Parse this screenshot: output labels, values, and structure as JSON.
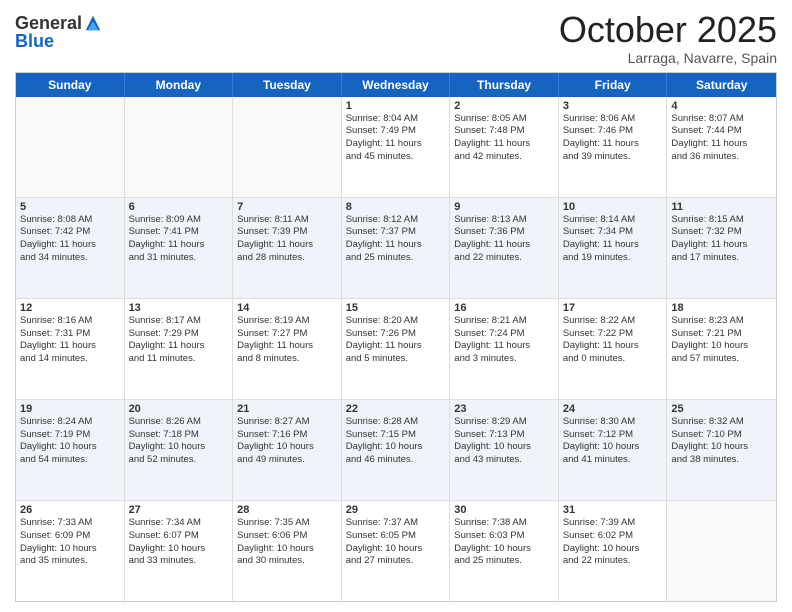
{
  "header": {
    "logo_general": "General",
    "logo_blue": "Blue",
    "month": "October 2025",
    "location": "Larraga, Navarre, Spain"
  },
  "weekdays": [
    "Sunday",
    "Monday",
    "Tuesday",
    "Wednesday",
    "Thursday",
    "Friday",
    "Saturday"
  ],
  "rows": [
    {
      "alt": false,
      "cells": [
        {
          "day": "",
          "lines": []
        },
        {
          "day": "",
          "lines": []
        },
        {
          "day": "",
          "lines": []
        },
        {
          "day": "1",
          "lines": [
            "Sunrise: 8:04 AM",
            "Sunset: 7:49 PM",
            "Daylight: 11 hours",
            "and 45 minutes."
          ]
        },
        {
          "day": "2",
          "lines": [
            "Sunrise: 8:05 AM",
            "Sunset: 7:48 PM",
            "Daylight: 11 hours",
            "and 42 minutes."
          ]
        },
        {
          "day": "3",
          "lines": [
            "Sunrise: 8:06 AM",
            "Sunset: 7:46 PM",
            "Daylight: 11 hours",
            "and 39 minutes."
          ]
        },
        {
          "day": "4",
          "lines": [
            "Sunrise: 8:07 AM",
            "Sunset: 7:44 PM",
            "Daylight: 11 hours",
            "and 36 minutes."
          ]
        }
      ]
    },
    {
      "alt": true,
      "cells": [
        {
          "day": "5",
          "lines": [
            "Sunrise: 8:08 AM",
            "Sunset: 7:42 PM",
            "Daylight: 11 hours",
            "and 34 minutes."
          ]
        },
        {
          "day": "6",
          "lines": [
            "Sunrise: 8:09 AM",
            "Sunset: 7:41 PM",
            "Daylight: 11 hours",
            "and 31 minutes."
          ]
        },
        {
          "day": "7",
          "lines": [
            "Sunrise: 8:11 AM",
            "Sunset: 7:39 PM",
            "Daylight: 11 hours",
            "and 28 minutes."
          ]
        },
        {
          "day": "8",
          "lines": [
            "Sunrise: 8:12 AM",
            "Sunset: 7:37 PM",
            "Daylight: 11 hours",
            "and 25 minutes."
          ]
        },
        {
          "day": "9",
          "lines": [
            "Sunrise: 8:13 AM",
            "Sunset: 7:36 PM",
            "Daylight: 11 hours",
            "and 22 minutes."
          ]
        },
        {
          "day": "10",
          "lines": [
            "Sunrise: 8:14 AM",
            "Sunset: 7:34 PM",
            "Daylight: 11 hours",
            "and 19 minutes."
          ]
        },
        {
          "day": "11",
          "lines": [
            "Sunrise: 8:15 AM",
            "Sunset: 7:32 PM",
            "Daylight: 11 hours",
            "and 17 minutes."
          ]
        }
      ]
    },
    {
      "alt": false,
      "cells": [
        {
          "day": "12",
          "lines": [
            "Sunrise: 8:16 AM",
            "Sunset: 7:31 PM",
            "Daylight: 11 hours",
            "and 14 minutes."
          ]
        },
        {
          "day": "13",
          "lines": [
            "Sunrise: 8:17 AM",
            "Sunset: 7:29 PM",
            "Daylight: 11 hours",
            "and 11 minutes."
          ]
        },
        {
          "day": "14",
          "lines": [
            "Sunrise: 8:19 AM",
            "Sunset: 7:27 PM",
            "Daylight: 11 hours",
            "and 8 minutes."
          ]
        },
        {
          "day": "15",
          "lines": [
            "Sunrise: 8:20 AM",
            "Sunset: 7:26 PM",
            "Daylight: 11 hours",
            "and 5 minutes."
          ]
        },
        {
          "day": "16",
          "lines": [
            "Sunrise: 8:21 AM",
            "Sunset: 7:24 PM",
            "Daylight: 11 hours",
            "and 3 minutes."
          ]
        },
        {
          "day": "17",
          "lines": [
            "Sunrise: 8:22 AM",
            "Sunset: 7:22 PM",
            "Daylight: 11 hours",
            "and 0 minutes."
          ]
        },
        {
          "day": "18",
          "lines": [
            "Sunrise: 8:23 AM",
            "Sunset: 7:21 PM",
            "Daylight: 10 hours",
            "and 57 minutes."
          ]
        }
      ]
    },
    {
      "alt": true,
      "cells": [
        {
          "day": "19",
          "lines": [
            "Sunrise: 8:24 AM",
            "Sunset: 7:19 PM",
            "Daylight: 10 hours",
            "and 54 minutes."
          ]
        },
        {
          "day": "20",
          "lines": [
            "Sunrise: 8:26 AM",
            "Sunset: 7:18 PM",
            "Daylight: 10 hours",
            "and 52 minutes."
          ]
        },
        {
          "day": "21",
          "lines": [
            "Sunrise: 8:27 AM",
            "Sunset: 7:16 PM",
            "Daylight: 10 hours",
            "and 49 minutes."
          ]
        },
        {
          "day": "22",
          "lines": [
            "Sunrise: 8:28 AM",
            "Sunset: 7:15 PM",
            "Daylight: 10 hours",
            "and 46 minutes."
          ]
        },
        {
          "day": "23",
          "lines": [
            "Sunrise: 8:29 AM",
            "Sunset: 7:13 PM",
            "Daylight: 10 hours",
            "and 43 minutes."
          ]
        },
        {
          "day": "24",
          "lines": [
            "Sunrise: 8:30 AM",
            "Sunset: 7:12 PM",
            "Daylight: 10 hours",
            "and 41 minutes."
          ]
        },
        {
          "day": "25",
          "lines": [
            "Sunrise: 8:32 AM",
            "Sunset: 7:10 PM",
            "Daylight: 10 hours",
            "and 38 minutes."
          ]
        }
      ]
    },
    {
      "alt": false,
      "cells": [
        {
          "day": "26",
          "lines": [
            "Sunrise: 7:33 AM",
            "Sunset: 6:09 PM",
            "Daylight: 10 hours",
            "and 35 minutes."
          ]
        },
        {
          "day": "27",
          "lines": [
            "Sunrise: 7:34 AM",
            "Sunset: 6:07 PM",
            "Daylight: 10 hours",
            "and 33 minutes."
          ]
        },
        {
          "day": "28",
          "lines": [
            "Sunrise: 7:35 AM",
            "Sunset: 6:06 PM",
            "Daylight: 10 hours",
            "and 30 minutes."
          ]
        },
        {
          "day": "29",
          "lines": [
            "Sunrise: 7:37 AM",
            "Sunset: 6:05 PM",
            "Daylight: 10 hours",
            "and 27 minutes."
          ]
        },
        {
          "day": "30",
          "lines": [
            "Sunrise: 7:38 AM",
            "Sunset: 6:03 PM",
            "Daylight: 10 hours",
            "and 25 minutes."
          ]
        },
        {
          "day": "31",
          "lines": [
            "Sunrise: 7:39 AM",
            "Sunset: 6:02 PM",
            "Daylight: 10 hours",
            "and 22 minutes."
          ]
        },
        {
          "day": "",
          "lines": []
        }
      ]
    }
  ]
}
